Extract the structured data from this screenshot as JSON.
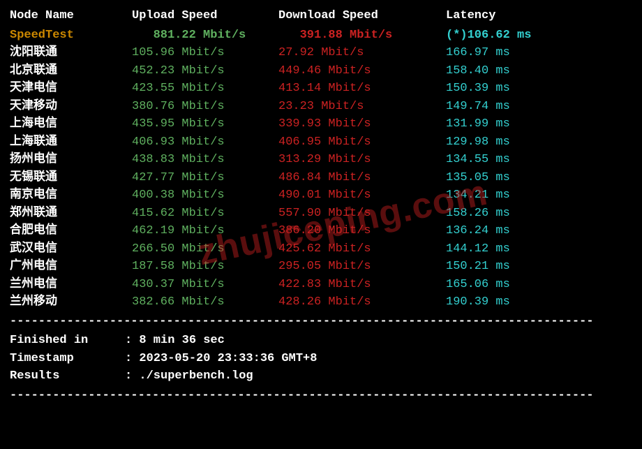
{
  "headers": {
    "node": "Node Name",
    "upload": "Upload Speed",
    "download": "Download Speed",
    "latency": "Latency"
  },
  "speedtest": {
    "node": "SpeedTest",
    "upload": "   881.22 Mbit/s",
    "download": "   391.88 Mbit/s",
    "latency": "   (*)106.62 ms"
  },
  "rows": [
    {
      "node": "沈阳联通",
      "upload": "105.96 Mbit/s",
      "download": "27.92 Mbit/s",
      "latency": "166.97 ms"
    },
    {
      "node": "北京联通",
      "upload": "452.23 Mbit/s",
      "download": "449.46 Mbit/s",
      "latency": "158.40 ms"
    },
    {
      "node": "天津电信",
      "upload": "423.55 Mbit/s",
      "download": "413.14 Mbit/s",
      "latency": "150.39 ms"
    },
    {
      "node": "天津移动",
      "upload": "380.76 Mbit/s",
      "download": "23.23 Mbit/s",
      "latency": "149.74 ms"
    },
    {
      "node": "上海电信",
      "upload": "435.95 Mbit/s",
      "download": "339.93 Mbit/s",
      "latency": "131.99 ms"
    },
    {
      "node": "上海联通",
      "upload": "406.93 Mbit/s",
      "download": "406.95 Mbit/s",
      "latency": "129.98 ms"
    },
    {
      "node": "扬州电信",
      "upload": "438.83 Mbit/s",
      "download": "313.29 Mbit/s",
      "latency": "134.55 ms"
    },
    {
      "node": "无锡联通",
      "upload": "427.77 Mbit/s",
      "download": "486.84 Mbit/s",
      "latency": "135.05 ms"
    },
    {
      "node": "南京电信",
      "upload": "400.38 Mbit/s",
      "download": "490.01 Mbit/s",
      "latency": "134.21 ms"
    },
    {
      "node": "郑州联通",
      "upload": "415.62 Mbit/s",
      "download": "557.90 Mbit/s",
      "latency": "158.26 ms"
    },
    {
      "node": "合肥电信",
      "upload": "462.19 Mbit/s",
      "download": "386.20 Mbit/s",
      "latency": "136.24 ms"
    },
    {
      "node": "武汉电信",
      "upload": "266.50 Mbit/s",
      "download": "425.62 Mbit/s",
      "latency": "144.12 ms"
    },
    {
      "node": "广州电信",
      "upload": "187.58 Mbit/s",
      "download": "295.05 Mbit/s",
      "latency": "150.21 ms"
    },
    {
      "node": "兰州电信",
      "upload": "430.37 Mbit/s",
      "download": "422.83 Mbit/s",
      "latency": "165.06 ms"
    },
    {
      "node": "兰州移动",
      "upload": "382.66 Mbit/s",
      "download": "428.26 Mbit/s",
      "latency": "190.39 ms"
    }
  ],
  "divider": "----------------------------------------------------------------------------------",
  "footer": {
    "finished_label": "Finished in",
    "finished_value": ": 8 min 36 sec",
    "timestamp_label": "Timestamp",
    "timestamp_value": ": 2023-05-20 23:33:36 GMT+8",
    "results_label": "Results",
    "results_value": ": ./superbench.log"
  },
  "watermark": "zhujiceping.com"
}
